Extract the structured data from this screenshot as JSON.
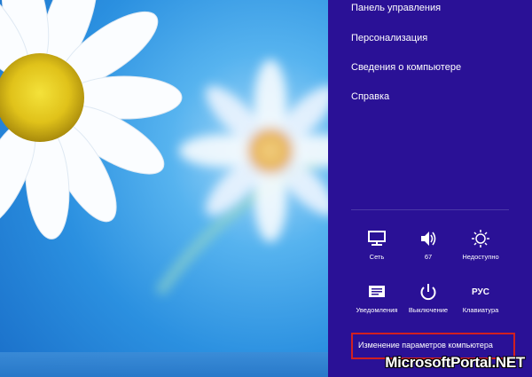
{
  "settings_pane": {
    "links": [
      "Панель управления",
      "Персонализация",
      "Сведения о компьютере",
      "Справка"
    ],
    "tiles": [
      {
        "label": "Сеть",
        "icon": "network-icon"
      },
      {
        "label": "67",
        "icon": "volume-icon"
      },
      {
        "label": "Недоступно",
        "icon": "brightness-icon"
      },
      {
        "label": "Уведомления",
        "icon": "notifications-icon"
      },
      {
        "label": "Выключение",
        "icon": "power-icon"
      },
      {
        "label": "Клавиатура",
        "icon": "keyboard-icon",
        "glyph": "РУС"
      }
    ],
    "change_pc_settings": "Изменение параметров компьютера",
    "highlight_color": "#d12020",
    "background_color": "#2a1196"
  },
  "watermark": "MicrosoftPortal.NET"
}
